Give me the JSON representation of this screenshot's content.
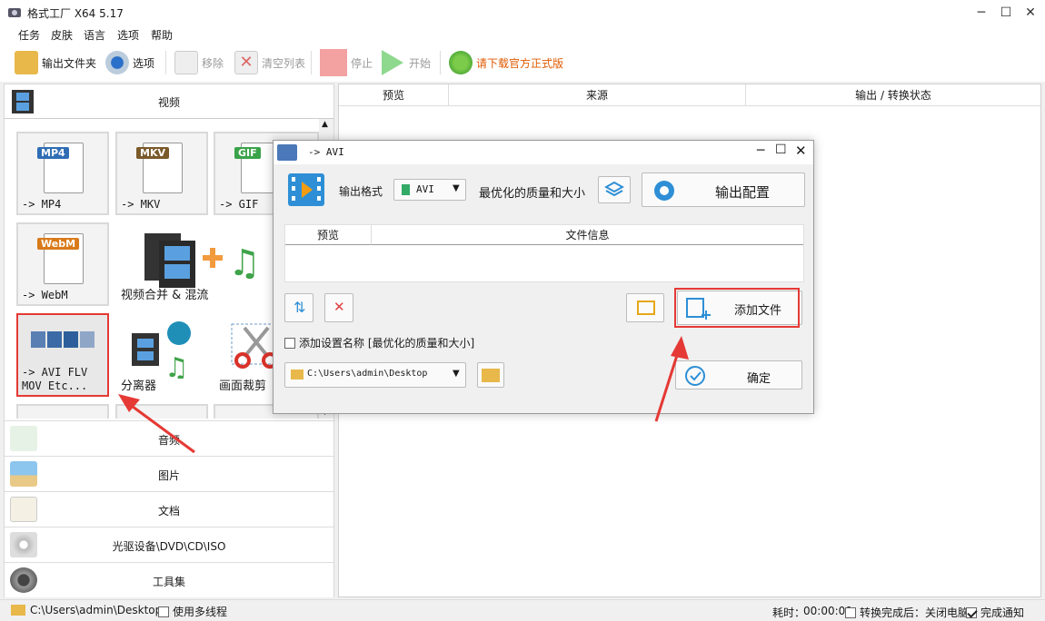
{
  "window": {
    "title": "格式工厂 X64 5.17",
    "min": "─",
    "max": "☐",
    "close": "✕"
  },
  "menu": [
    "任务",
    "皮肤",
    "语言",
    "选项",
    "帮助"
  ],
  "toolbar": {
    "output_folder": "输出文件夹",
    "options": "选项",
    "remove": "移除",
    "clear_list": "清空列表",
    "stop": "停止",
    "start": "开始",
    "download": "请下载官方正式版"
  },
  "left": {
    "video_label": "视频",
    "tiles": [
      {
        "label": "-> MP4",
        "badge": "MP4",
        "badge_color": "#2f6eb5"
      },
      {
        "label": "-> MKV",
        "badge": "MKV",
        "badge_color": "#7a5a2a"
      },
      {
        "label": "-> GIF",
        "badge": "GIF",
        "badge_color": "#3aa34a"
      },
      {
        "label": "-> WebM",
        "badge": "WebM",
        "badge_color": "#d97a1a"
      },
      {
        "label": "视频合并 & 混流"
      },
      {
        "label": "-> AVI FLV\nMOV Etc..."
      },
      {
        "label": "分离器"
      },
      {
        "label": "画面裁剪"
      }
    ],
    "categories": [
      "音频",
      "图片",
      "文档",
      "光驱设备\\DVD\\CD\\ISO",
      "工具集"
    ]
  },
  "filelist": {
    "headers": [
      "预览",
      "来源",
      "输出 / 转换状态"
    ]
  },
  "status": {
    "path": "C:\\Users\\admin\\Desktop",
    "multithread": "使用多线程",
    "elapsed_label": "耗时：",
    "elapsed": "00:00:00",
    "after_convert": "转换完成后：关闭电脑",
    "notify": "完成通知"
  },
  "dialog": {
    "title": "-> AVI",
    "format_label": "输出格式",
    "format_value": "AVI",
    "quality": "最优化的质量和大小",
    "output_config": "输出配置",
    "headers": [
      "预览",
      "文件信息"
    ],
    "add_file": "添加文件",
    "add_setting_name": "添加设置名称 [最优化的质量和大小]",
    "folder": "C:\\Users\\admin\\Desktop",
    "ok": "确定"
  }
}
